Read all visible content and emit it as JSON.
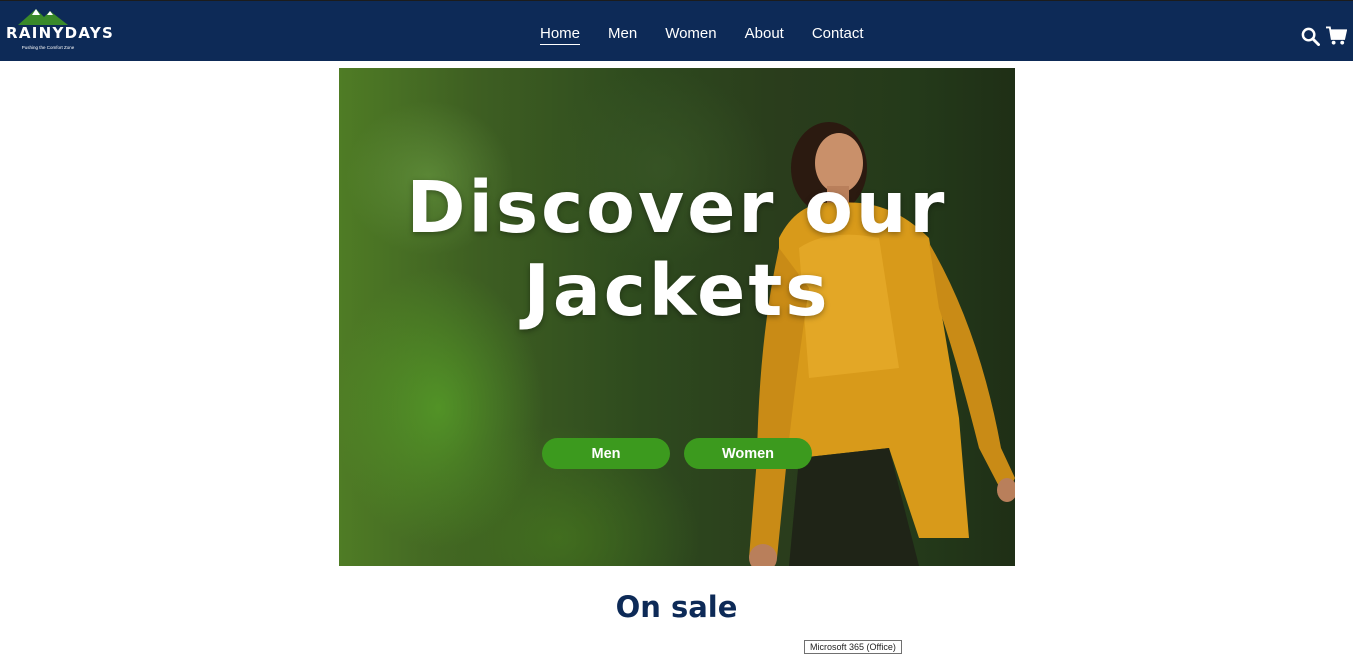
{
  "brand": {
    "name": "RAINYDAYS",
    "tagline": "Pushing the Comfort Zone"
  },
  "nav": {
    "links": [
      {
        "label": "Home",
        "active": true
      },
      {
        "label": "Men",
        "active": false
      },
      {
        "label": "Women",
        "active": false
      },
      {
        "label": "About",
        "active": false
      },
      {
        "label": "Contact",
        "active": false
      }
    ],
    "icons": [
      "search-icon",
      "cart-icon"
    ]
  },
  "hero": {
    "title": "Discover our Jackets",
    "buttons": {
      "men": "Men",
      "women": "Women"
    }
  },
  "sections": {
    "on_sale_title": "On sale"
  },
  "tooltip": {
    "text": "Microsoft 365 (Office)"
  },
  "colors": {
    "navbar": "#0d2a57",
    "button": "#3c9a1e",
    "heading": "#0d2a57"
  }
}
